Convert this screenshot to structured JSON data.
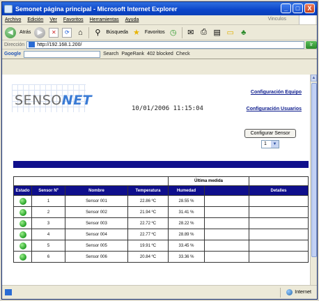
{
  "window": {
    "title": "Semonet página principal - Microsoft Internet Explorer",
    "controls": {
      "minimize": "_",
      "maximize": "□",
      "close": "X"
    }
  },
  "menu": {
    "items": [
      "Archivo",
      "Edición",
      "Ver",
      "Favoritos",
      "Herramientas",
      "Ayuda"
    ],
    "links_label": "Vinculos"
  },
  "toolbar": {
    "back_label": "Atrás",
    "search_label": "Búsqueda",
    "favorites_label": "Favoritos"
  },
  "address": {
    "label": "Dirección",
    "url": "http://192.168.1.200/",
    "go": "Ir"
  },
  "google": {
    "logo": "Google",
    "search": "Search",
    "pagerank": "PageRank",
    "blocked": "402 blocked",
    "check": "Check"
  },
  "page": {
    "logo_part1": "SENSO",
    "logo_part2": "NET",
    "datetime": "10/01/2006 11:15:04",
    "link_equipo": "Configuración Equipo",
    "link_usuarios": "Configuración Usuarios",
    "config_sensor_button": "Configurar Sensor",
    "sensor_select_value": "1"
  },
  "table": {
    "group_header": "Última medida",
    "columns": [
      "Estado",
      "Sensor Nº",
      "Nombre",
      "Temperatura",
      "Humedad",
      "",
      "Detalles"
    ],
    "rows": [
      {
        "sensor": "1",
        "nombre": "Sensor 001",
        "temp": "22.86 ºC",
        "hum": "28.55 %"
      },
      {
        "sensor": "2",
        "nombre": "Sensor 002",
        "temp": "21.94 ºC",
        "hum": "31.41 %"
      },
      {
        "sensor": "3",
        "nombre": "Sensor 003",
        "temp": "22.72 ºC",
        "hum": "28.22 %"
      },
      {
        "sensor": "4",
        "nombre": "Sensor 004",
        "temp": "22.77 ºC",
        "hum": "28.89 %"
      },
      {
        "sensor": "5",
        "nombre": "Sensor 005",
        "temp": "19.91 ºC",
        "hum": "33.45 %"
      },
      {
        "sensor": "6",
        "nombre": "Sensor 006",
        "temp": "20.84 ºC",
        "hum": "33.36 %"
      }
    ]
  },
  "status": {
    "zone": "Internet"
  },
  "colors": {
    "banner": "#0f0f8c",
    "status_ok": "#2aa52a",
    "link": "#0b1a8c"
  }
}
